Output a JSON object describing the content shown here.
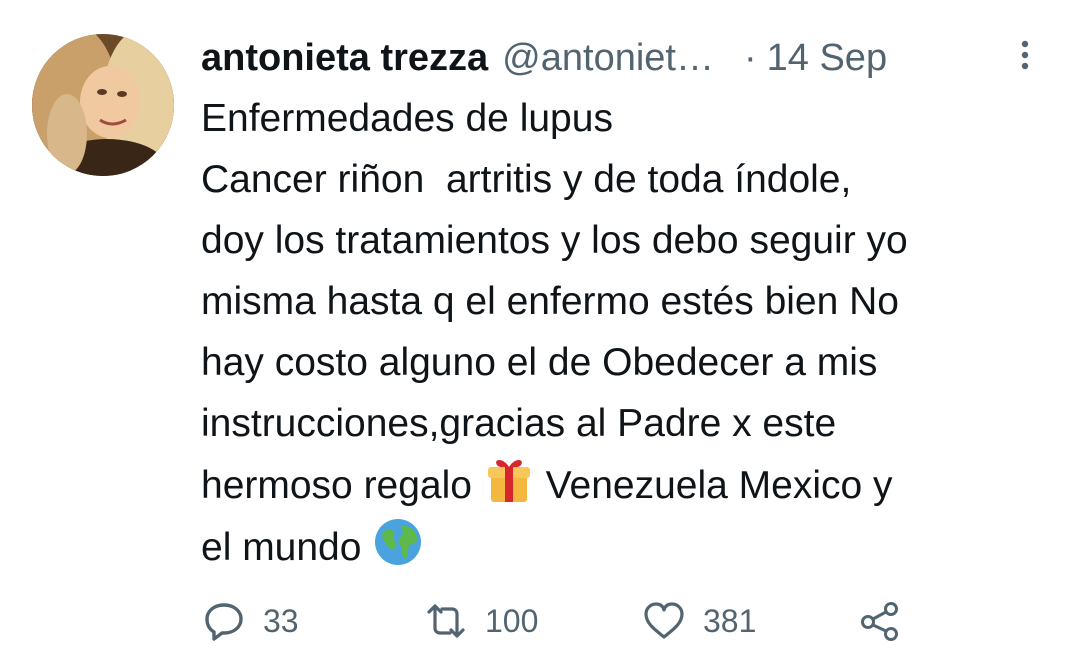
{
  "tweet": {
    "author": {
      "name": "antonieta trezza",
      "handle": "@antoniet…"
    },
    "separator": "·",
    "date": "14 Sep",
    "text_lines": [
      "Enfermedades de lupus",
      "Cancer riñon  artritis y de toda índole,",
      "doy los tratamientos y los debo seguir yo",
      "misma hasta q el enfermo estés bien No",
      "hay costo alguno el de Obedecer a mis",
      "instrucciones,gracias al Padre x este",
      "hermoso regalo",
      "Venezuela Mexico y",
      "el mundo"
    ],
    "emojis": [
      "gift-icon",
      "globe-icon"
    ],
    "stats": {
      "replies": "33",
      "retweets": "100",
      "likes": "381"
    }
  },
  "colors": {
    "text": "#0f1419",
    "secondary": "#536471",
    "background": "#ffffff"
  }
}
